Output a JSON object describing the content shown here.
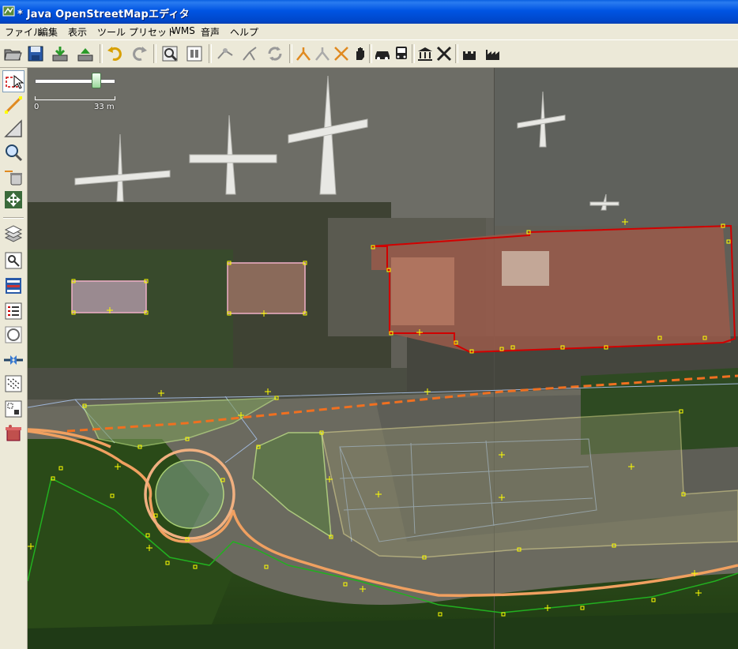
{
  "window": {
    "title": "* Java OpenStreetMapエディタ"
  },
  "menu": [
    {
      "label": "ファイル",
      "key": "file"
    },
    {
      "label": "編集",
      "key": "edit"
    },
    {
      "label": "表示",
      "key": "view"
    },
    {
      "label": "ツール",
      "key": "tools"
    },
    {
      "label": "プリセット",
      "key": "presets"
    },
    {
      "label": "WMS",
      "key": "wms"
    },
    {
      "label": "音声",
      "key": "audio"
    },
    {
      "label": "ヘルプ",
      "key": "help"
    }
  ],
  "toolbar_icons": [
    "open-icon",
    "save-icon",
    "download-icon",
    "upload-icon",
    "undo-icon",
    "redo-icon",
    "preferences-icon",
    "layer-properties-icon",
    "merge-nodes-icon",
    "split-way-icon",
    "refresh-icon",
    "combine-way-icon",
    "unglue-icon",
    "align-icon",
    "hand-icon",
    "car-icon",
    "bus-icon",
    "building-icon",
    "cross-icon",
    "castle-icon",
    "industrial-icon"
  ],
  "sidebar_icons": [
    "select-tool-icon",
    "draw-tool-icon",
    "angle-tool-icon",
    "zoom-tool-icon",
    "delete-tool-icon",
    "move-tool-icon",
    "layers-dialog-icon",
    "properties-dialog-icon",
    "selection-list-icon",
    "relation-list-icon",
    "author-dialog-icon",
    "conflict-dialog-icon",
    "command-stack-icon",
    "history-dialog-icon",
    "validator-icon"
  ],
  "scale": {
    "min_label": "0",
    "max_label": "33 m",
    "zoom_level": 0.77
  },
  "colors": {
    "titlebar": "#0054e3",
    "building_outline": "#d10000",
    "road_orange": "#f08a3a",
    "area_green": "#c8f08a",
    "selection_node": "#ffff00",
    "boundary_green": "#22b020"
  }
}
